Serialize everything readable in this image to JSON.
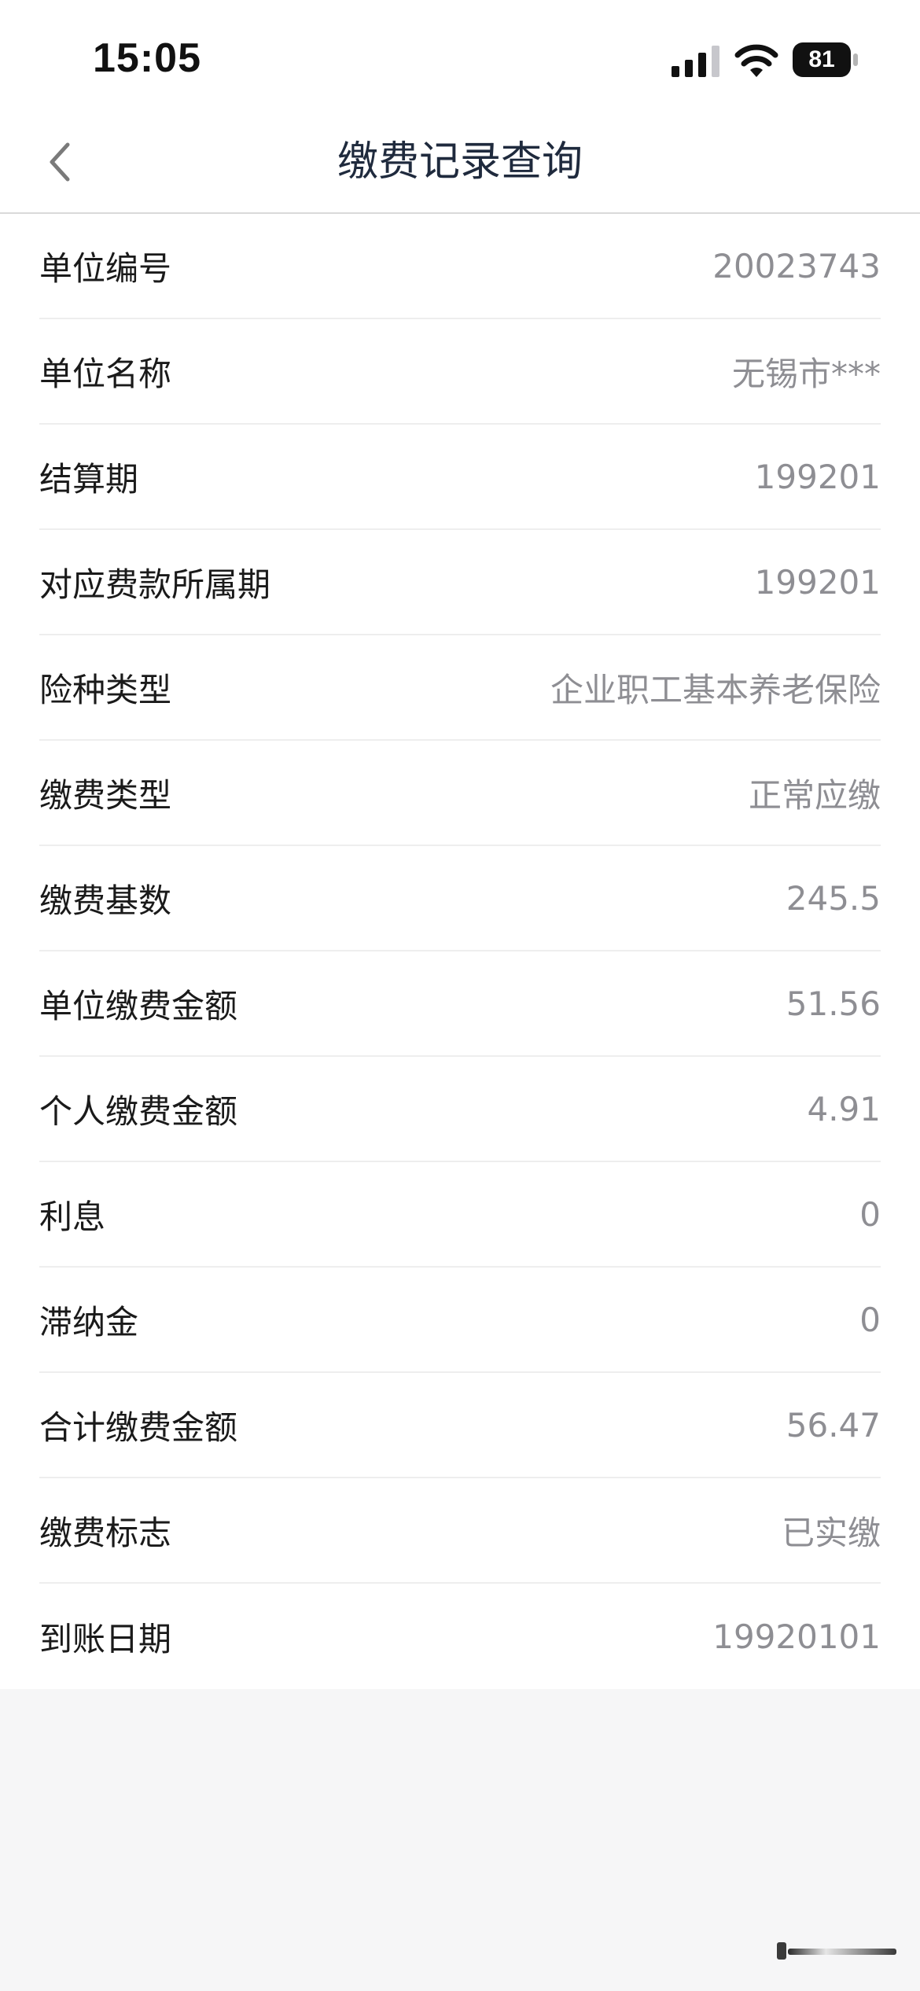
{
  "status_bar": {
    "time": "15:05",
    "battery_level": "81",
    "icons": [
      "signal-icon",
      "wifi-icon",
      "battery-icon"
    ]
  },
  "nav": {
    "back_icon": "chevron-left-icon",
    "title": "缴费记录查询"
  },
  "rows": [
    {
      "label": "单位编号",
      "value": "20023743"
    },
    {
      "label": "单位名称",
      "value": "无锡市***"
    },
    {
      "label": "结算期",
      "value": "199201"
    },
    {
      "label": "对应费款所属期",
      "value": "199201"
    },
    {
      "label": "险种类型",
      "value": "企业职工基本养老保险"
    },
    {
      "label": "缴费类型",
      "value": "正常应缴"
    },
    {
      "label": "缴费基数",
      "value": "245.5"
    },
    {
      "label": "单位缴费金额",
      "value": "51.56"
    },
    {
      "label": "个人缴费金额",
      "value": "4.91"
    },
    {
      "label": "利息",
      "value": "0"
    },
    {
      "label": "滞纳金",
      "value": "0"
    },
    {
      "label": "合计缴费金额",
      "value": "56.47"
    },
    {
      "label": "缴费标志",
      "value": "已实缴"
    },
    {
      "label": "到账日期",
      "value": "19920101"
    }
  ],
  "colors": {
    "title": "#1f2a3d",
    "label": "#1a1a1a",
    "value": "#8e8e93",
    "page_background": "#f6f6f7",
    "divider": "#eeeeee"
  }
}
